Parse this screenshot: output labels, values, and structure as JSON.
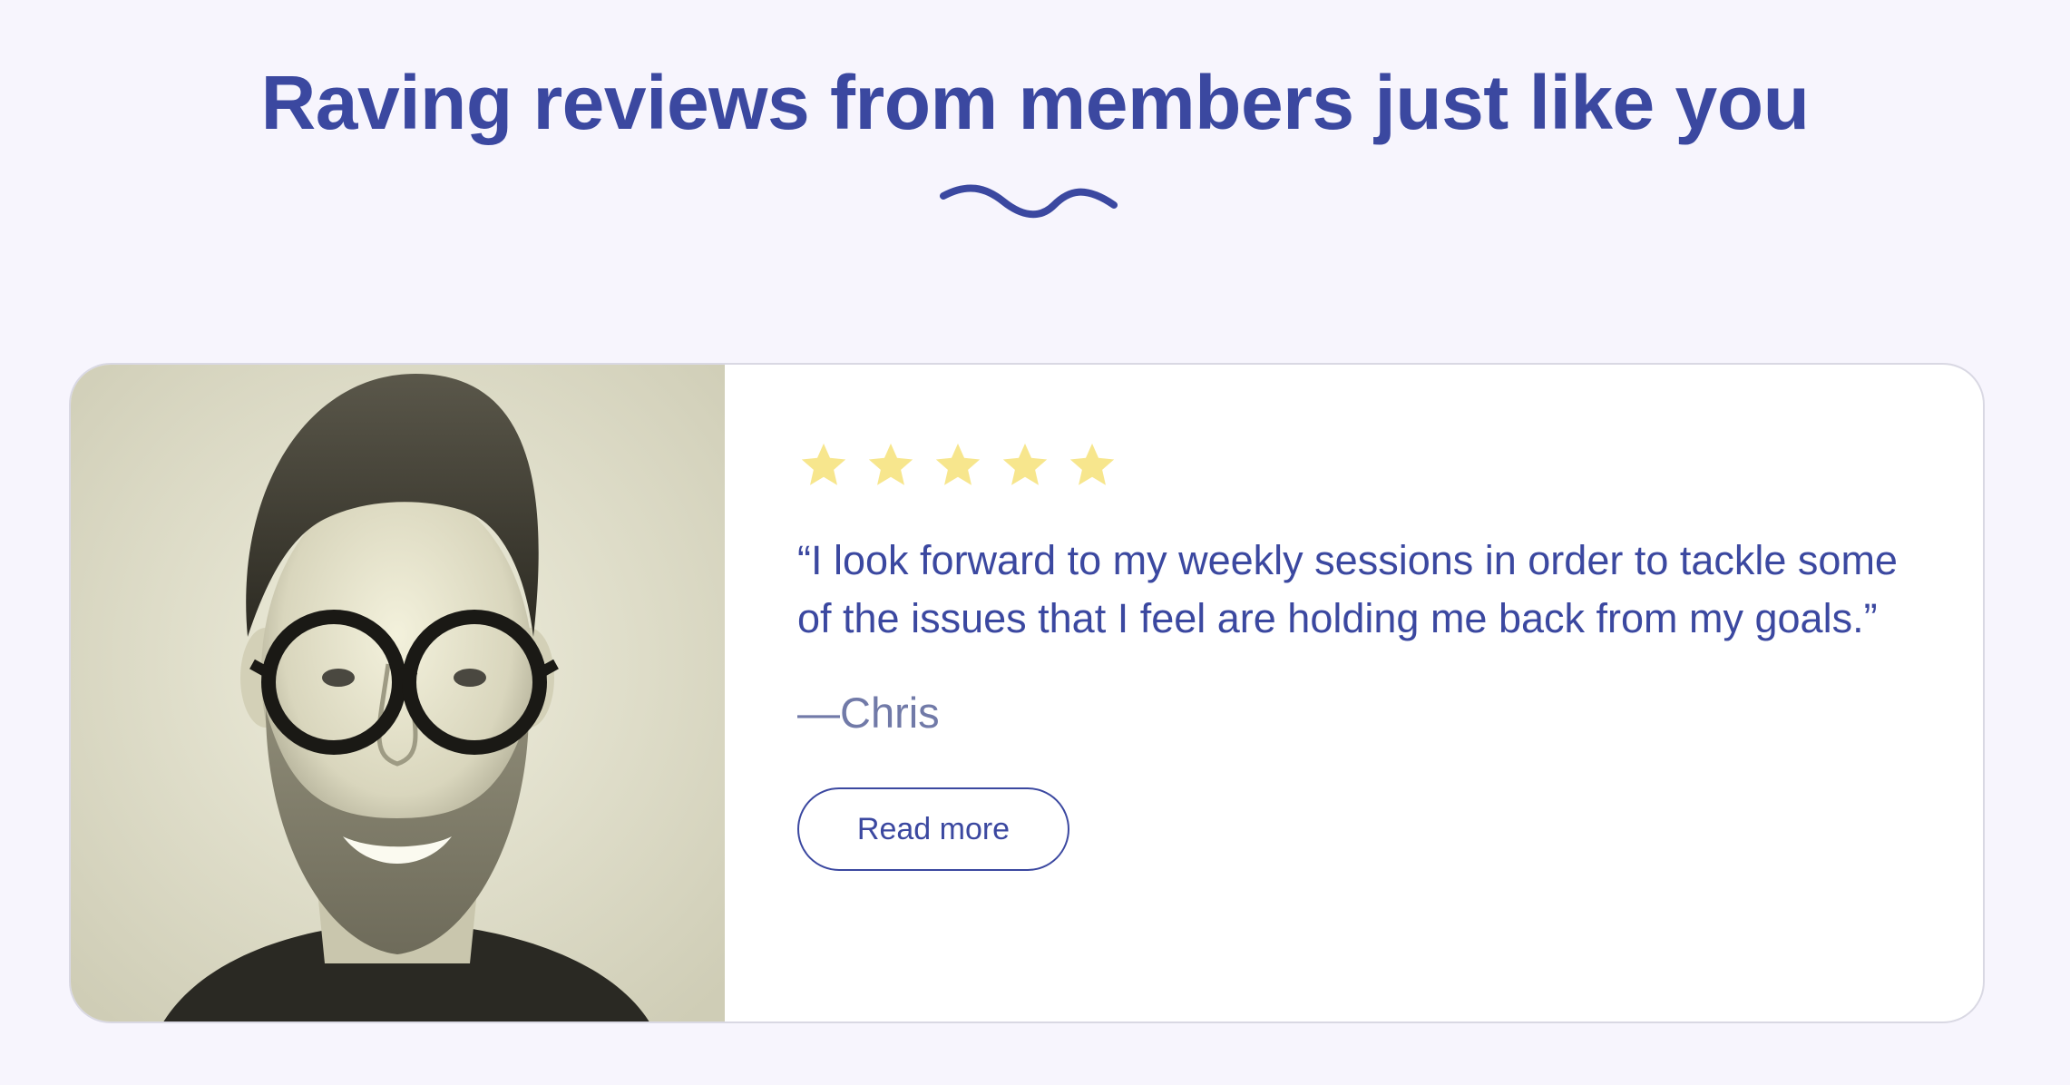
{
  "section": {
    "title": "Raving reviews from members just like you",
    "accent_color": "#3b48a0",
    "background_color": "#f7f5fd"
  },
  "review": {
    "rating": 5,
    "rating_max": 5,
    "star_color": "#f7e68d",
    "quote": "“I look forward to my weekly sessions in order to tackle some of the issues that I feel are holding me back from my goals.”",
    "author": "—Chris",
    "read_more_label": "Read more",
    "photo_icon": "member-photo"
  }
}
